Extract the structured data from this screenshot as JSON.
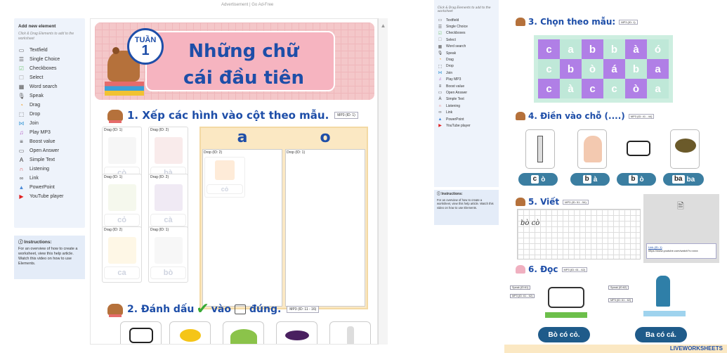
{
  "ad_text": "Advertisement | Go Ad-Free",
  "left": {
    "sidebar": {
      "title": "Add new element",
      "hint": "Click & Drag Elements to add to the worksheet",
      "items": [
        {
          "label": "Textfield",
          "icon": "textfield-icon",
          "color": "#555"
        },
        {
          "label": "Single Choice",
          "icon": "single-choice-icon",
          "color": "#555"
        },
        {
          "label": "Checkboxes",
          "icon": "checkbox-icon",
          "color": "#7fc97f"
        },
        {
          "label": "Select",
          "icon": "select-icon",
          "color": "#aaa"
        },
        {
          "label": "Word search",
          "icon": "word-search-icon",
          "color": "#555"
        },
        {
          "label": "Speak",
          "icon": "microphone-icon",
          "color": "#555"
        },
        {
          "label": "Drag",
          "icon": "drag-icon",
          "color": "#f0a030"
        },
        {
          "label": "Drop",
          "icon": "drop-icon",
          "color": "#555"
        },
        {
          "label": "Join",
          "icon": "join-icon",
          "color": "#4aa0d8"
        },
        {
          "label": "Play MP3",
          "icon": "music-icon",
          "color": "#b050c0"
        },
        {
          "label": "Boost value",
          "icon": "boost-icon",
          "color": "#333"
        },
        {
          "label": "Open Answer",
          "icon": "open-answer-icon",
          "color": "#555"
        },
        {
          "label": "Simple Text",
          "icon": "text-icon",
          "color": "#333"
        },
        {
          "label": "Listening",
          "icon": "headphones-icon",
          "color": "#e05050"
        },
        {
          "label": "Link",
          "icon": "link-icon",
          "color": "#555"
        },
        {
          "label": "PowerPoint",
          "icon": "powerpoint-icon",
          "color": "#4a8ad8"
        },
        {
          "label": "YouTube player",
          "icon": "youtube-icon",
          "color": "#e02020"
        }
      ]
    },
    "instructions": {
      "title": "ⓘ Instructions:",
      "text": "For an overview of how to create a worksheet, view this help article. Watch this video on how to use Elements."
    },
    "banner": {
      "tuan": "TUẦN",
      "week": "1",
      "title": "Những chữ cái đầu tiên"
    },
    "sec1": {
      "title": "1. Xếp các hình vào cột theo mẫu.",
      "mp3": "MP3 (ID: 1)"
    },
    "cards": [
      {
        "drag": "Drag (ID: 1)",
        "word": "cò"
      },
      {
        "drag": "Drag (ID: 2)",
        "word": "bà"
      },
      {
        "drag": "Drag (ID: 1)",
        "word": "cỏ"
      },
      {
        "drag": "Drag (ID: 2)",
        "word": "cà"
      },
      {
        "drag": "Drag (ID: 2)",
        "word": "ca"
      },
      {
        "drag": "Drag (ID: 1)",
        "word": "bò"
      }
    ],
    "col_a": {
      "header": "a",
      "drop": "Drop (ID: 2)",
      "card_word": "cỏ"
    },
    "col_o": {
      "header": "o",
      "drop": "Drop (ID: 1)"
    },
    "sec2": {
      "pre": "2. Đánh dấu",
      "mid": "vào",
      "post": "đúng.",
      "mp3": "MP3 (ID: 11 - 16)"
    }
  },
  "right": {
    "hint": "Click & Drag Elements to add to the worksheet",
    "items": [
      "Textfield",
      "Single Choice",
      "Checkboxes",
      "Select",
      "Word search",
      "Speak",
      "Drag",
      "Drop",
      "Join",
      "Play MP3",
      "Boost value",
      "Open Answer",
      "Simple Text",
      "Listening",
      "Link",
      "PowerPoint",
      "YouTube player"
    ],
    "instructions": {
      "title": "ⓘ Instructions:",
      "text": "For an overview of how to create a worksheet, view this help article. Watch this video on how to use Elements."
    },
    "sec3": {
      "title": "3. Chọn theo mẫu:",
      "mp3": "MP3 (ID: 1)"
    },
    "grid": [
      [
        "c",
        "a",
        "b",
        "b",
        "à",
        "ó"
      ],
      [
        "c",
        "b",
        "ò",
        "á",
        "b",
        "a"
      ],
      [
        "c",
        "à",
        "c",
        "c",
        "ò",
        "a"
      ]
    ],
    "grid_colors": [
      "#bfe8d8",
      "#b07fe6"
    ],
    "sec4": {
      "title": "4. Điền vào chỗ (....)",
      "mp3": "MP3 (ID: 41 - 44)"
    },
    "words4": [
      {
        "fill": "c",
        "rest": "ò"
      },
      {
        "fill": "b",
        "rest": "à"
      },
      {
        "fill": "b",
        "rest": "ò"
      },
      {
        "fill": "ba",
        "rest": "ba"
      }
    ],
    "sec5": {
      "title": "5. Viết",
      "mp3": "MP3 (ID: 51 - 54)",
      "sample": "bò cò"
    },
    "video": {
      "label": "Link (ID: 1)",
      "url": "https://www.youtube.com/watch?v=xxxx"
    },
    "sec6": {
      "title": "6. Đọc",
      "mp3": "MP3 (ID: 61 - 62)"
    },
    "speak_tags": [
      "Speak (ID:61)",
      "MP3 (ID: 61 - 62)",
      "Speak (ID:62)",
      "MP3 (ID: 61 - 62)"
    ],
    "read": [
      "Bò có cỏ.",
      "Ba có cá."
    ],
    "footer": "LIVEWORKSHEETS"
  }
}
